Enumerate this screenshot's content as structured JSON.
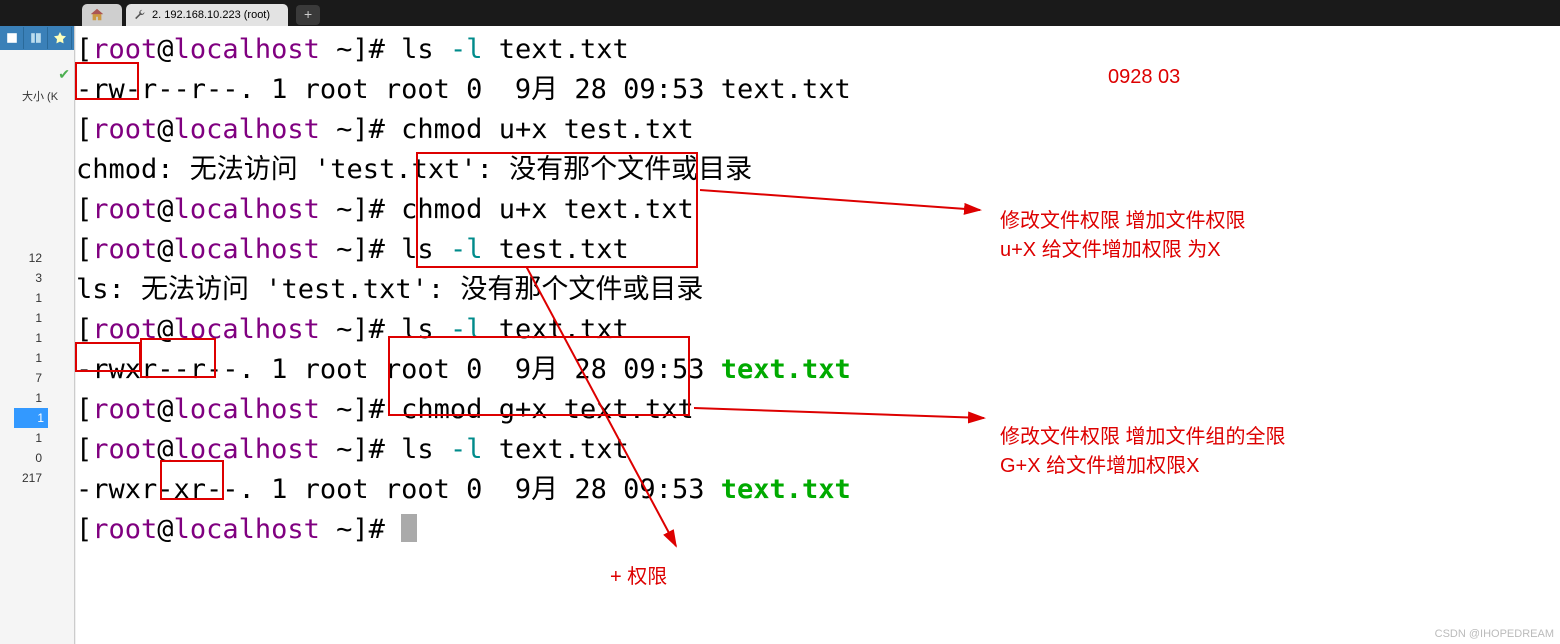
{
  "tabbar": {
    "active_label": "2. 192.168.10.223 (root)",
    "add_label": "+"
  },
  "sidebar": {
    "size_label": "大小 (K",
    "numbers": [
      "12",
      "3",
      "1",
      "1",
      "1",
      "1",
      "7",
      "1",
      "1",
      "1",
      "0",
      "217"
    ],
    "selected": "1"
  },
  "terminal": {
    "lines": [
      {
        "prompt_user": "root",
        "prompt_host": "localhost",
        "prompt_path": "~",
        "cmd": "ls -l",
        "arg": "text.txt"
      },
      {
        "text": "-rw-r--r--. 1 root root 0  9月 28 09:53 text.txt"
      },
      {
        "prompt_user": "root",
        "prompt_host": "localhost",
        "prompt_path": "~",
        "cmd": "chmod u+x test.txt"
      },
      {
        "text": "chmod: 无法访问 'test.txt': 没有那个文件或目录"
      },
      {
        "prompt_user": "root",
        "prompt_host": "localhost",
        "prompt_path": "~",
        "cmd": "chmod u+x text.txt"
      },
      {
        "prompt_user": "root",
        "prompt_host": "localhost",
        "prompt_path": "~",
        "cmd": "ls -l",
        "arg": "test.txt"
      },
      {
        "text": "ls: 无法访问 'test.txt': 没有那个文件或目录"
      },
      {
        "prompt_user": "root",
        "prompt_host": "localhost",
        "prompt_path": "~",
        "cmd": "ls -l",
        "arg": "text.txt"
      },
      {
        "text_pre": "-rwxr--r--. 1 root root 0  9月 28 09:53 ",
        "green": "text.txt"
      },
      {
        "prompt_user": "root",
        "prompt_host": "localhost",
        "prompt_path": "~",
        "cmd": "chmod g+x text.txt"
      },
      {
        "prompt_user": "root",
        "prompt_host": "localhost",
        "prompt_path": "~",
        "cmd": "ls -l",
        "arg": "text.txt"
      },
      {
        "text_pre": "-rwxr-xr--. 1 root root 0  9月 28 09:53 ",
        "green": "text.txt"
      },
      {
        "prompt_user": "root",
        "prompt_host": "localhost",
        "prompt_path": "~",
        "cursor": true
      }
    ]
  },
  "annotations": {
    "date": "0928 03",
    "note1_l1": "修改文件权限 增加文件权限",
    "note1_l2": "u+X 给文件增加权限 为X",
    "note2_l1": "修改文件权限 增加文件组的全限",
    "note2_l2": "G+X 给文件增加权限X",
    "note3": "+ 权限"
  },
  "watermark": "CSDN @IHOPEDREAM"
}
